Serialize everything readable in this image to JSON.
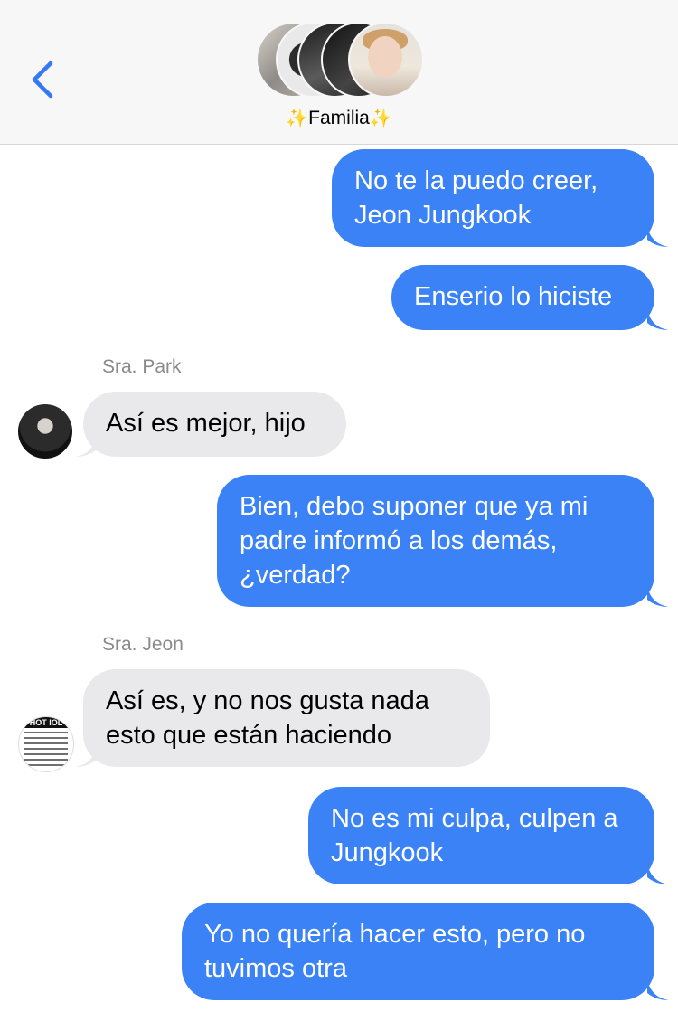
{
  "header": {
    "back_icon": "chevron-left-icon",
    "group_name": "Familia",
    "group_emoji": "✨"
  },
  "messages": [
    {
      "direction": "out",
      "text": "No te la puedo creer, Jeon Jungkook"
    },
    {
      "direction": "out",
      "text": "Enserio lo hiciste"
    },
    {
      "direction": "in",
      "sender": "Sra. Park",
      "text": "Así es mejor, hijo"
    },
    {
      "direction": "out",
      "text": "Bien, debo suponer que ya mi padre informó a los demás, ¿verdad?"
    },
    {
      "direction": "in",
      "sender": "Sra. Jeon",
      "text": "Así es, y no nos gusta nada esto que están haciendo"
    },
    {
      "direction": "out",
      "text": "No es mi culpa, culpen a Jungkook"
    },
    {
      "direction": "out",
      "text": "Yo no quería hacer esto, pero no tuvimos otra"
    }
  ],
  "avatar_badge_text": "HOT IOL",
  "colors": {
    "outgoing_bubble": "#3a82f6",
    "incoming_bubble": "#e9e9eb",
    "accent": "#3478f6",
    "header_bg": "#f7f7f7"
  }
}
